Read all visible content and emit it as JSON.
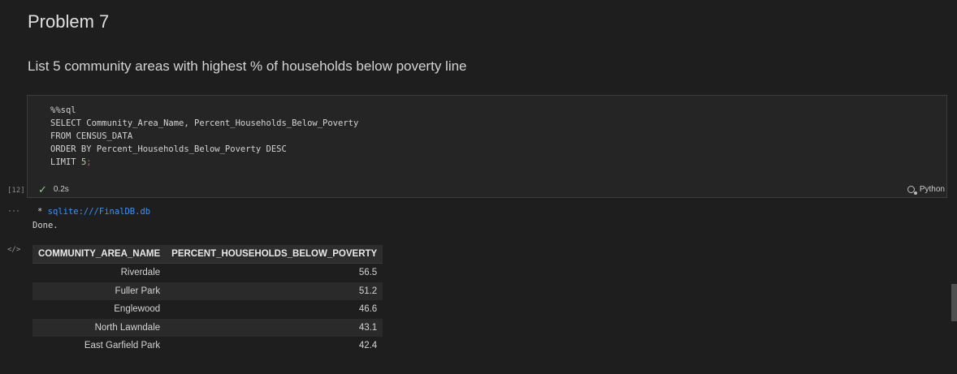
{
  "markdown": {
    "title": "Problem 7",
    "text": "List 5 community areas with highest % of households below poverty line"
  },
  "code_cell": {
    "lines": {
      "l1": "%%sql",
      "l2": "SELECT Community_Area_Name, Percent_Households_Below_Poverty",
      "l3": "FROM CENSUS_DATA",
      "l4": "ORDER BY Percent_Households_Below_Poverty DESC",
      "l5_prefix": "LIMIT ",
      "l5_num": "5",
      "l5_semi": ";"
    },
    "execution_count": "[12]",
    "duration": "0.2s",
    "kernel": "Python"
  },
  "output": {
    "more_label": "···",
    "code_icon": "</>",
    "star": " * ",
    "connection": "sqlite:///FinalDB.db",
    "done": "Done.",
    "table": {
      "headers": [
        "COMMUNITY_AREA_NAME",
        "PERCENT_HOUSEHOLDS_BELOW_POVERTY"
      ],
      "rows": [
        [
          "Riverdale",
          "56.5"
        ],
        [
          "Fuller Park",
          "51.2"
        ],
        [
          "Englewood",
          "46.6"
        ],
        [
          "North Lawndale",
          "43.1"
        ],
        [
          "East Garfield Park",
          "42.4"
        ]
      ]
    }
  },
  "icons": {
    "status": "check-icon",
    "kernel": "kernel-icon"
  },
  "colors": {
    "background": "#1e1e1e",
    "success": "#89d185",
    "link": "#3794ff"
  }
}
